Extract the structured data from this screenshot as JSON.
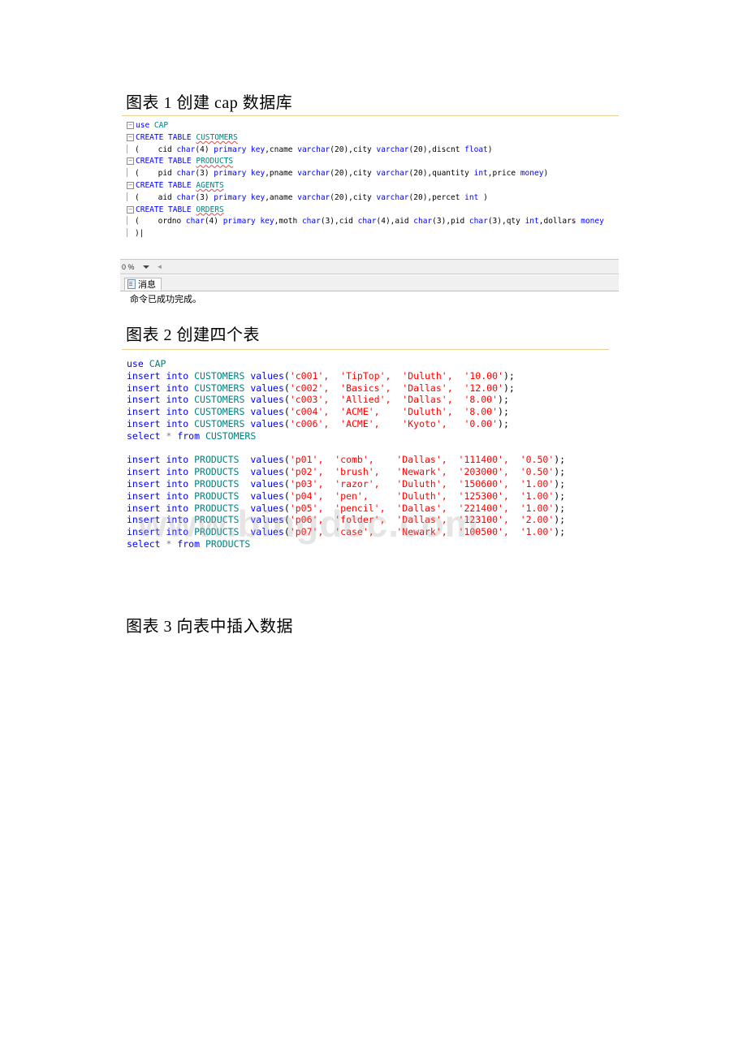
{
  "captions": {
    "fig1": "图表 1 创建 cap 数据库",
    "fig2": "图表 2 创建四个表",
    "fig3": "图表 3 向表中插入数据"
  },
  "editor1": {
    "lines": [
      {
        "fold": "box",
        "tokens": [
          {
            "t": "use ",
            "c": "kw"
          },
          {
            "t": "CAP",
            "c": "obj"
          }
        ]
      },
      {
        "fold": "box",
        "tokens": [
          {
            "t": "CREATE TABLE ",
            "c": "kw"
          },
          {
            "t": "CUSTOMERS",
            "c": "squig"
          }
        ]
      },
      {
        "fold": "bar",
        "tokens": [
          {
            "t": "(    cid ",
            "c": "plain"
          },
          {
            "t": "char",
            "c": "kw"
          },
          {
            "t": "(4) ",
            "c": "plain"
          },
          {
            "t": "primary key",
            "c": "kw"
          },
          {
            "t": ",cname ",
            "c": "plain"
          },
          {
            "t": "varchar",
            "c": "kw"
          },
          {
            "t": "(20),city ",
            "c": "plain"
          },
          {
            "t": "varchar",
            "c": "kw"
          },
          {
            "t": "(20),discnt ",
            "c": "plain"
          },
          {
            "t": "float",
            "c": "kw"
          },
          {
            "t": ")",
            "c": "plain"
          }
        ]
      },
      {
        "fold": "box",
        "tokens": [
          {
            "t": "CREATE TABLE ",
            "c": "kw"
          },
          {
            "t": "PRODUCTS",
            "c": "squig"
          }
        ]
      },
      {
        "fold": "bar",
        "tokens": [
          {
            "t": "(    pid ",
            "c": "plain"
          },
          {
            "t": "char",
            "c": "kw"
          },
          {
            "t": "(3) ",
            "c": "plain"
          },
          {
            "t": "primary key",
            "c": "kw"
          },
          {
            "t": ",pname ",
            "c": "plain"
          },
          {
            "t": "varchar",
            "c": "kw"
          },
          {
            "t": "(20),city ",
            "c": "plain"
          },
          {
            "t": "varchar",
            "c": "kw"
          },
          {
            "t": "(20),quantity ",
            "c": "plain"
          },
          {
            "t": "int",
            "c": "kw"
          },
          {
            "t": ",price ",
            "c": "plain"
          },
          {
            "t": "money",
            "c": "kw"
          },
          {
            "t": ")",
            "c": "plain"
          }
        ]
      },
      {
        "fold": "box",
        "tokens": [
          {
            "t": "CREATE TABLE ",
            "c": "kw"
          },
          {
            "t": "AGENTS",
            "c": "squig"
          }
        ]
      },
      {
        "fold": "bar",
        "tokens": [
          {
            "t": "(    aid ",
            "c": "plain"
          },
          {
            "t": "char",
            "c": "kw"
          },
          {
            "t": "(3) ",
            "c": "plain"
          },
          {
            "t": "primary key",
            "c": "kw"
          },
          {
            "t": ",aname ",
            "c": "plain"
          },
          {
            "t": "varchar",
            "c": "kw"
          },
          {
            "t": "(20),city ",
            "c": "plain"
          },
          {
            "t": "varchar",
            "c": "kw"
          },
          {
            "t": "(20),percet ",
            "c": "plain"
          },
          {
            "t": "int",
            "c": "kw"
          },
          {
            "t": " )",
            "c": "plain"
          }
        ]
      },
      {
        "fold": "box",
        "tokens": [
          {
            "t": "CREATE TABLE ",
            "c": "kw"
          },
          {
            "t": "ORDERS",
            "c": "squig"
          }
        ]
      },
      {
        "fold": "bar",
        "tokens": [
          {
            "t": "(    ordno ",
            "c": "plain"
          },
          {
            "t": "char",
            "c": "kw"
          },
          {
            "t": "(4) ",
            "c": "plain"
          },
          {
            "t": "primary key",
            "c": "kw"
          },
          {
            "t": ",moth ",
            "c": "plain"
          },
          {
            "t": "char",
            "c": "kw"
          },
          {
            "t": "(3),cid ",
            "c": "plain"
          },
          {
            "t": "char",
            "c": "kw"
          },
          {
            "t": "(4),aid ",
            "c": "plain"
          },
          {
            "t": "char",
            "c": "kw"
          },
          {
            "t": "(3),pid ",
            "c": "plain"
          },
          {
            "t": "char",
            "c": "kw"
          },
          {
            "t": "(3),qty ",
            "c": "plain"
          },
          {
            "t": "int",
            "c": "kw"
          },
          {
            "t": ",dollars ",
            "c": "plain"
          },
          {
            "t": "money",
            "c": "kw"
          }
        ]
      },
      {
        "fold": "bar",
        "tokens": [
          {
            "t": ")|",
            "c": "plain"
          }
        ]
      }
    ]
  },
  "status": {
    "zoom_level": "0 %",
    "tab_label": "消息",
    "message": "命令已成功完成。"
  },
  "editor2": {
    "lines": [
      {
        "tokens": [
          {
            "t": "use ",
            "c": "kw"
          },
          {
            "t": "CAP",
            "c": "obj"
          }
        ]
      },
      {
        "tokens": [
          {
            "t": "insert into ",
            "c": "kw"
          },
          {
            "t": "CUSTOMERS ",
            "c": "obj"
          },
          {
            "t": "values",
            "c": "kw"
          },
          {
            "t": "(",
            "c": "plain"
          },
          {
            "t": "'c001',  'TipTop',  'Duluth',  '10.00'",
            "c": "str"
          },
          {
            "t": ");",
            "c": "plain"
          }
        ]
      },
      {
        "tokens": [
          {
            "t": "insert into ",
            "c": "kw"
          },
          {
            "t": "CUSTOMERS ",
            "c": "obj"
          },
          {
            "t": "values",
            "c": "kw"
          },
          {
            "t": "(",
            "c": "plain"
          },
          {
            "t": "'c002',  'Basics',  'Dallas',  '12.00'",
            "c": "str"
          },
          {
            "t": ");",
            "c": "plain"
          }
        ]
      },
      {
        "tokens": [
          {
            "t": "insert into ",
            "c": "kw"
          },
          {
            "t": "CUSTOMERS ",
            "c": "obj"
          },
          {
            "t": "values",
            "c": "kw"
          },
          {
            "t": "(",
            "c": "plain"
          },
          {
            "t": "'c003',  'Allied',  'Dallas',  '8.00'",
            "c": "str"
          },
          {
            "t": ");",
            "c": "plain"
          }
        ]
      },
      {
        "tokens": [
          {
            "t": "insert into ",
            "c": "kw"
          },
          {
            "t": "CUSTOMERS ",
            "c": "obj"
          },
          {
            "t": "values",
            "c": "kw"
          },
          {
            "t": "(",
            "c": "plain"
          },
          {
            "t": "'c004',  'ACME',    'Duluth',  '8.00'",
            "c": "str"
          },
          {
            "t": ");",
            "c": "plain"
          }
        ]
      },
      {
        "tokens": [
          {
            "t": "insert into ",
            "c": "kw"
          },
          {
            "t": "CUSTOMERS ",
            "c": "obj"
          },
          {
            "t": "values",
            "c": "kw"
          },
          {
            "t": "(",
            "c": "plain"
          },
          {
            "t": "'c006',  'ACME',    'Kyoto',   '0.00'",
            "c": "str"
          },
          {
            "t": ");",
            "c": "plain"
          }
        ]
      },
      {
        "tokens": [
          {
            "t": "select ",
            "c": "kw"
          },
          {
            "t": "* ",
            "c": "gray"
          },
          {
            "t": "from ",
            "c": "kw"
          },
          {
            "t": "CUSTOMERS",
            "c": "obj"
          }
        ]
      },
      {
        "tokens": []
      },
      {
        "tokens": [
          {
            "t": "insert into ",
            "c": "kw"
          },
          {
            "t": "PRODUCTS  ",
            "c": "obj"
          },
          {
            "t": "values",
            "c": "kw"
          },
          {
            "t": "(",
            "c": "plain"
          },
          {
            "t": "'p01',  'comb',    'Dallas',  '111400',  '0.50'",
            "c": "str"
          },
          {
            "t": ");",
            "c": "plain"
          }
        ]
      },
      {
        "tokens": [
          {
            "t": "insert into ",
            "c": "kw"
          },
          {
            "t": "PRODUCTS  ",
            "c": "obj"
          },
          {
            "t": "values",
            "c": "kw"
          },
          {
            "t": "(",
            "c": "plain"
          },
          {
            "t": "'p02',  'brush',   'Newark',  '203000',  '0.50'",
            "c": "str"
          },
          {
            "t": ");",
            "c": "plain"
          }
        ]
      },
      {
        "tokens": [
          {
            "t": "insert into ",
            "c": "kw"
          },
          {
            "t": "PRODUCTS  ",
            "c": "obj"
          },
          {
            "t": "values",
            "c": "kw"
          },
          {
            "t": "(",
            "c": "plain"
          },
          {
            "t": "'p03',  'razor',   'Duluth',  '150600',  '1.00'",
            "c": "str"
          },
          {
            "t": ");",
            "c": "plain"
          }
        ]
      },
      {
        "tokens": [
          {
            "t": "insert into ",
            "c": "kw"
          },
          {
            "t": "PRODUCTS  ",
            "c": "obj"
          },
          {
            "t": "values",
            "c": "kw"
          },
          {
            "t": "(",
            "c": "plain"
          },
          {
            "t": "'p04',  'pen',     'Duluth',  '125300',  '1.00'",
            "c": "str"
          },
          {
            "t": ");",
            "c": "plain"
          }
        ]
      },
      {
        "tokens": [
          {
            "t": "insert into ",
            "c": "kw"
          },
          {
            "t": "PRODUCTS  ",
            "c": "obj"
          },
          {
            "t": "values",
            "c": "kw"
          },
          {
            "t": "(",
            "c": "plain"
          },
          {
            "t": "'p05',  'pencil',  'Dallas',  '221400',  '1.00'",
            "c": "str"
          },
          {
            "t": ");",
            "c": "plain"
          }
        ]
      },
      {
        "tokens": [
          {
            "t": "insert into ",
            "c": "kw"
          },
          {
            "t": "PRODUCTS  ",
            "c": "obj"
          },
          {
            "t": "values",
            "c": "kw"
          },
          {
            "t": "(",
            "c": "plain"
          },
          {
            "t": "'p06',  'folder',  'Dallas',  '123100',  '2.00'",
            "c": "str"
          },
          {
            "t": ");",
            "c": "plain"
          }
        ]
      },
      {
        "tokens": [
          {
            "t": "insert into ",
            "c": "kw"
          },
          {
            "t": "PRODUCTS  ",
            "c": "obj"
          },
          {
            "t": "values",
            "c": "kw"
          },
          {
            "t": "(",
            "c": "plain"
          },
          {
            "t": "'p07',  'case',    'Newark',  '100500',  '1.00'",
            "c": "str"
          },
          {
            "t": ");",
            "c": "plain"
          }
        ]
      },
      {
        "tokens": [
          {
            "t": "select ",
            "c": "kw"
          },
          {
            "t": "* ",
            "c": "gray"
          },
          {
            "t": "from ",
            "c": "kw"
          },
          {
            "t": "PRODUCTS",
            "c": "obj"
          }
        ]
      }
    ]
  },
  "watermark": {
    "text": "www.bingdoc.com"
  }
}
